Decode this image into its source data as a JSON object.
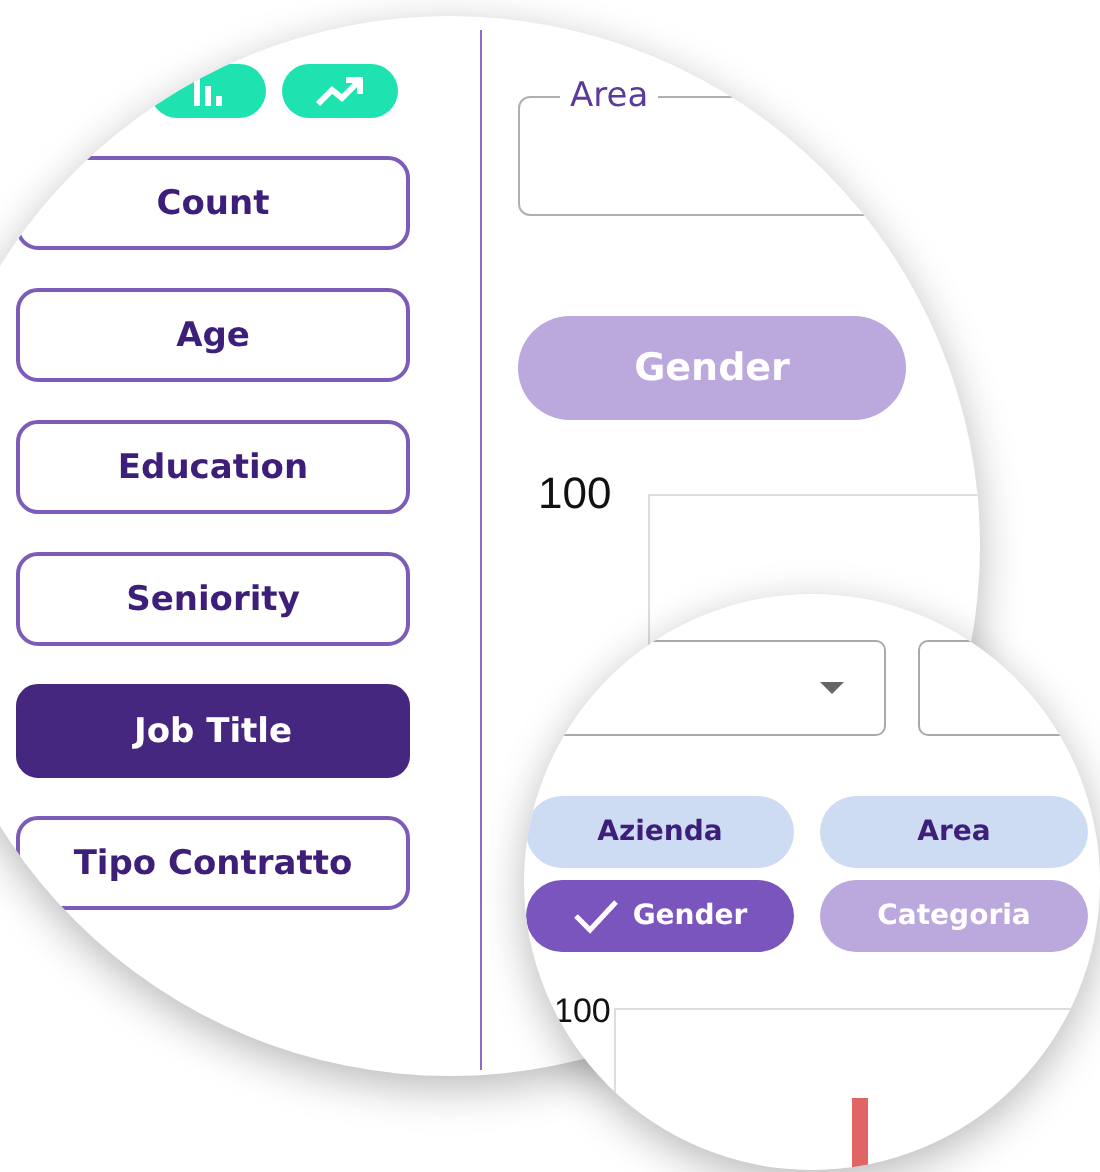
{
  "main_view": {
    "sidebar": {
      "items": [
        {
          "label": "Count",
          "selected": false
        },
        {
          "label": "Age",
          "selected": false
        },
        {
          "label": "Education",
          "selected": false
        },
        {
          "label": "Seniority",
          "selected": false
        },
        {
          "label": "Job Title",
          "selected": true
        },
        {
          "label": "Tipo Contratto",
          "selected": false
        }
      ]
    },
    "area_field": {
      "label": "Area"
    },
    "group_button": {
      "label": "Gender"
    },
    "chart": {
      "y_tick": "100"
    }
  },
  "zoom_view": {
    "chips": [
      {
        "label": "Azienda",
        "selected": false,
        "disabled": false
      },
      {
        "label": "Area",
        "selected": false,
        "disabled": false
      },
      {
        "label": "Gender",
        "selected": true,
        "disabled": false
      },
      {
        "label": "Categoria",
        "selected": false,
        "disabled": true
      }
    ],
    "chart": {
      "y_tick": "100"
    }
  }
}
